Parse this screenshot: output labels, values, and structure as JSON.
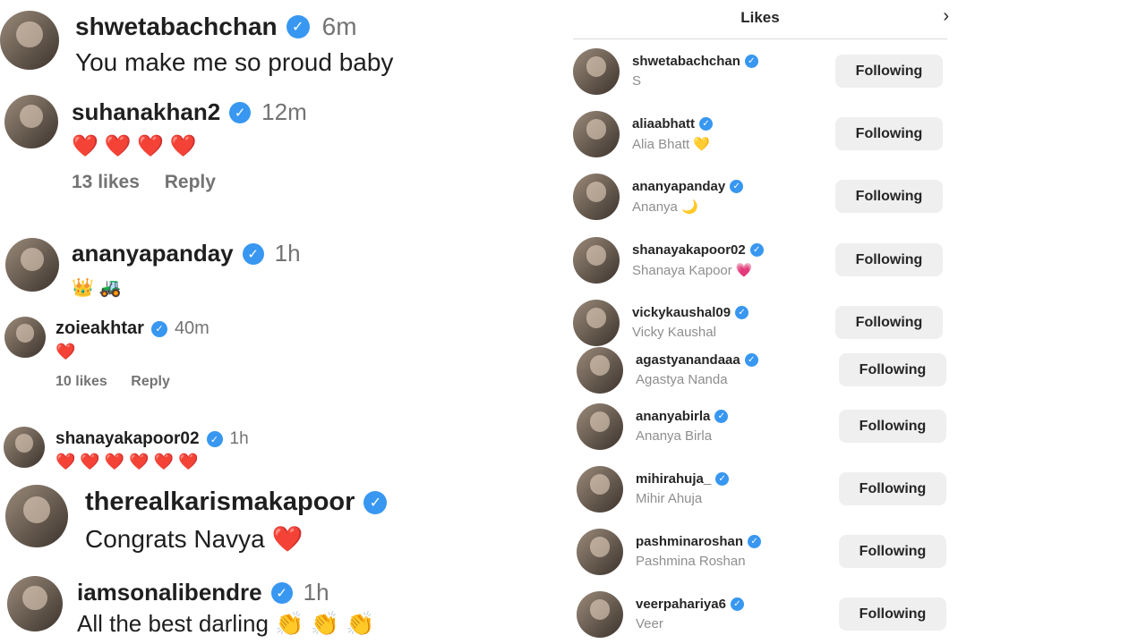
{
  "comments": [
    {
      "username": "shwetabachchan",
      "time": "6m",
      "text": "You make me so proud baby",
      "actions": null
    },
    {
      "username": "suhanakhan2",
      "time": "12m",
      "text": "❤️ ❤️ ❤️ ❤️",
      "actions": {
        "likes": "13 likes",
        "reply": "Reply"
      }
    },
    {
      "username": "ananyapanday",
      "time": "1h",
      "text": "👑 🚜",
      "actions": null
    },
    {
      "username": "zoieakhtar",
      "time": "40m",
      "text": "❤️",
      "actions": {
        "likes": "10 likes",
        "reply": "Reply"
      }
    },
    {
      "username": "shanayakapoor02",
      "time": "1h",
      "text": "❤️ ❤️ ❤️ ❤️ ❤️ ❤️",
      "actions": null
    },
    {
      "username": "therealkarismakapoor",
      "time": "",
      "text": "Congrats Navya ❤️",
      "actions": null
    },
    {
      "username": "iamsonalibendre",
      "time": "1h",
      "text": "All the best darling 👏 👏 👏",
      "actions": null
    }
  ],
  "likes_panel": {
    "title": "Likes",
    "close_icon": "chevron-right-icon",
    "follow_label": "Following",
    "users": [
      {
        "username": "shwetabachchan",
        "name": "S"
      },
      {
        "username": "aliaabhatt",
        "name": "Alia Bhatt 💛"
      },
      {
        "username": "ananyapanday",
        "name": "Ananya 🌙"
      },
      {
        "username": "shanayakapoor02",
        "name": "Shanaya Kapoor 💗"
      },
      {
        "username": "vickykaushal09",
        "name": "Vicky Kaushal"
      },
      {
        "username": "agastyanandaaa",
        "name": "Agastya Nanda"
      },
      {
        "username": "ananyabirla",
        "name": "Ananya Birla"
      },
      {
        "username": "mihirahuja_",
        "name": "Mihir Ahuja"
      },
      {
        "username": "pashminaroshan",
        "name": "Pashmina Roshan"
      },
      {
        "username": "veerpahariya6",
        "name": "Veer"
      }
    ]
  },
  "colors": {
    "verified": "#3897f0",
    "secondary_text": "#737373",
    "button_bg": "#efefef"
  }
}
